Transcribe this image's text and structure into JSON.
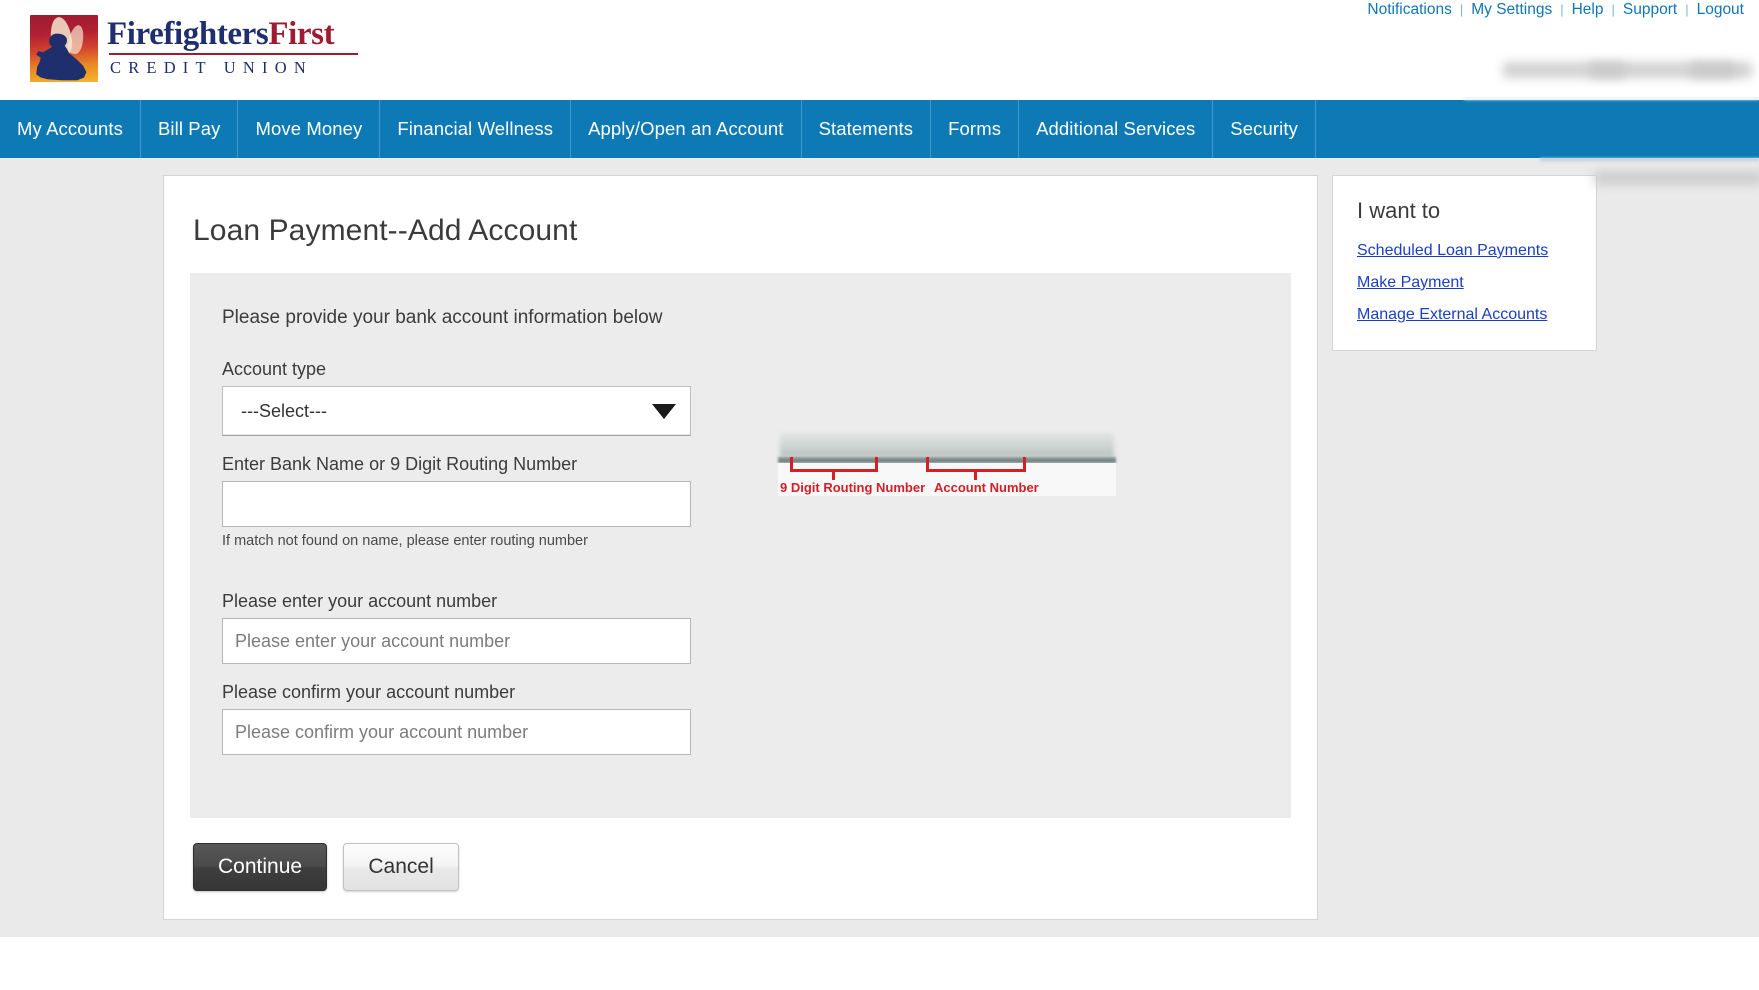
{
  "header": {
    "utility_links": [
      "Notifications",
      "My Settings",
      "Help",
      "Support",
      "Logout"
    ],
    "separator": "|",
    "logo": {
      "word1": "Firefighters",
      "word2": "First",
      "subtitle": "CREDIT UNION",
      "icon": "firefighter-flame-logo"
    }
  },
  "mainnav": {
    "items": [
      "My Accounts",
      "Bill Pay",
      "Move Money",
      "Financial Wellness",
      "Apply/Open an Account",
      "Statements",
      "Forms",
      "Additional Services",
      "Security"
    ]
  },
  "main": {
    "page_title": "Loan Payment--Add Account",
    "form": {
      "intro": "Please provide your bank account information below",
      "account_type_label": "Account type",
      "account_type_value": "---Select---",
      "routing_label": "Enter Bank Name or 9 Digit Routing Number",
      "routing_value": "",
      "routing_help": "If match not found on name, please enter routing number",
      "account_number_label": "Please enter your account number",
      "account_number_placeholder": "Please enter your account number",
      "account_number_value": "",
      "confirm_account_label": "Please confirm your account number",
      "confirm_account_placeholder": "Please confirm your account number",
      "confirm_account_value": ""
    },
    "check_image": {
      "routing_caption": "9 Digit Routing Number",
      "account_caption": "Account Number"
    },
    "buttons": {
      "continue": "Continue",
      "cancel": "Cancel"
    }
  },
  "sidebar": {
    "title": "I want to",
    "links": [
      "Scheduled Loan Payments",
      "Make Payment",
      "Manage External Accounts"
    ]
  },
  "colors": {
    "nav_blue": "#0d7ab5",
    "link_blue": "#1176b5",
    "side_link_blue": "#1a3fbf",
    "logo_navy": "#1f2f6e",
    "logo_red": "#9e1b32",
    "caption_red": "#d12026",
    "page_bg": "#eaeaea",
    "panel_bg": "#ececec"
  }
}
